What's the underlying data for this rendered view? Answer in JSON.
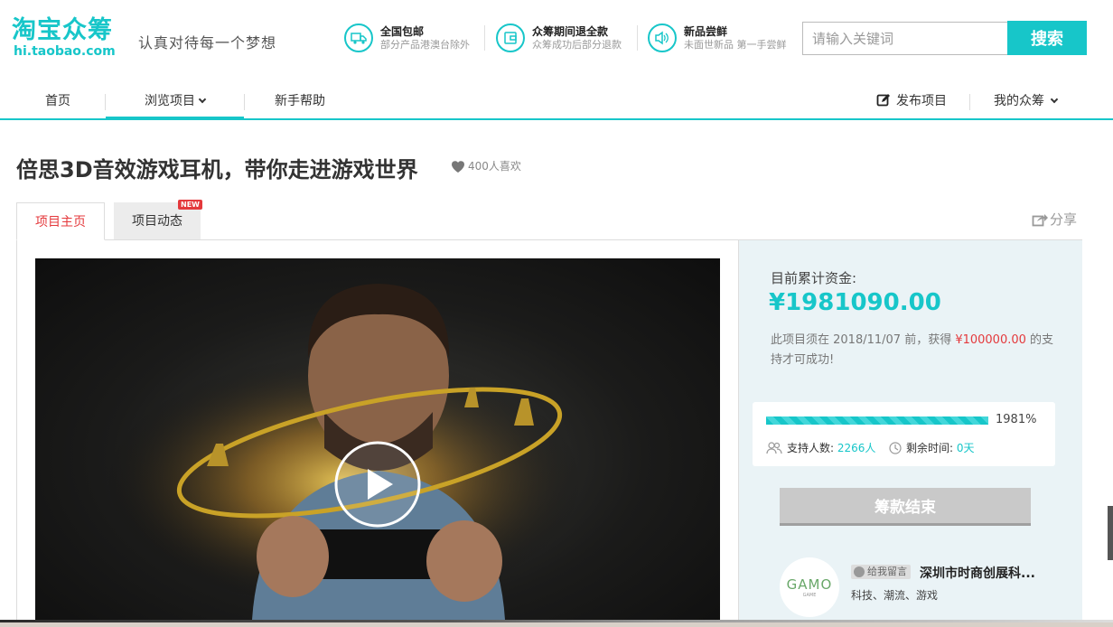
{
  "header": {
    "logo_cn": "淘宝众筹",
    "logo_url": "hi.taobao.com",
    "slogan": "认真对待每一个梦想",
    "promos": [
      {
        "icon": "truck-icon",
        "title": "全国包邮",
        "sub": "部分产品港澳台除外"
      },
      {
        "icon": "wallet-icon",
        "title": "众筹期间退全款",
        "sub": "众筹成功后部分退款"
      },
      {
        "icon": "speaker-icon",
        "title": "新品尝鲜",
        "sub": "未面世新品 第一手尝鲜"
      }
    ],
    "search_placeholder": "请输入关键词",
    "search_button": "搜索"
  },
  "nav": {
    "home": "首页",
    "browse": "浏览项目",
    "help": "新手帮助",
    "publish": "发布项目",
    "mine": "我的众筹"
  },
  "project": {
    "title": "倍思3D音效游戏耳机，带你走进游戏世界",
    "likes": "400人喜欢"
  },
  "tabs": {
    "main": "项目主页",
    "news": "项目动态",
    "news_badge": "NEW",
    "share": "分享"
  },
  "funding": {
    "label": "目前累计资金:",
    "amount": "¥1981090.00",
    "rule_prefix": "此项目须在 2018/11/07 前，获得 ",
    "rule_goal": "¥100000.00",
    "rule_suffix": " 的支持才可成功!",
    "percent_text": "1981%",
    "progress_fraction": 1.0,
    "supporters_label": "支持人数:",
    "supporters_value": "2266人",
    "remaining_label": "剩余时间:",
    "remaining_value": "0天",
    "status_button": "筹款结束"
  },
  "sponsor": {
    "avatar_text": "GAMO",
    "avatar_sub": "GAME",
    "message_tag": "给我留言",
    "company": "深圳市时商创展科...",
    "tags": "科技、潮流、游戏"
  },
  "colors": {
    "accent": "#17c6c9",
    "price_red": "#e4393c",
    "panel_bg": "#eaf3f6"
  }
}
